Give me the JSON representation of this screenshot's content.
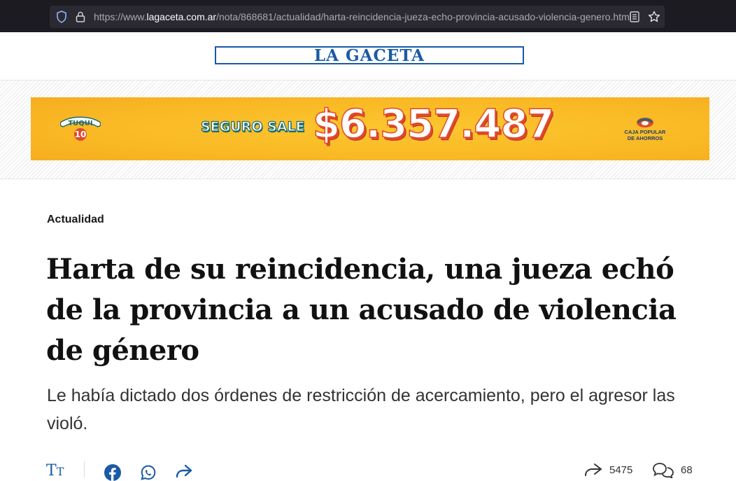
{
  "browser": {
    "url_prefix": "https://www.",
    "url_host": "lagaceta.com.ar",
    "url_path": "/nota/868681/actualidad/harta-reincidencia-jueza-echo-provincia-acusado-violencia-genero.html"
  },
  "site": {
    "logo_text": "LA GACETA",
    "brand_color": "#1a5aa6"
  },
  "ad": {
    "product_logo_top": "TUQUI",
    "product_logo_bottom": "10",
    "tagline": "SEGURO SALE",
    "amount": "$6.357.487",
    "sponsor_line1": "CAJA POPULAR",
    "sponsor_line2": "DE AHORROS",
    "background_color": "#f9b925"
  },
  "article": {
    "section": "Actualidad",
    "headline": "Harta de su reincidencia, una jueza echó de la provincia a un acusado de violencia de género",
    "summary": "Le había dictado dos órdenes de restricción de acercamiento, pero el agresor las violó."
  },
  "toolbar": {
    "text_size_label": "T",
    "shares_count": "5475",
    "comments_count": "68"
  }
}
